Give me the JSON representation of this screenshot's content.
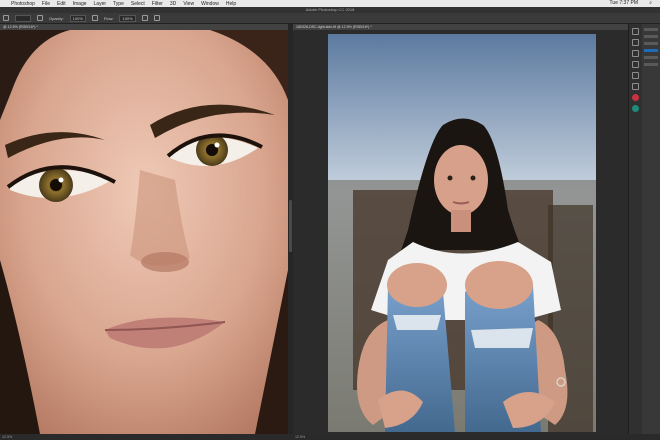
{
  "menubar": {
    "items": [
      "Photoshop",
      "File",
      "Edit",
      "Image",
      "Layer",
      "Type",
      "Select",
      "Filter",
      "3D",
      "View",
      "Window",
      "Help"
    ],
    "clock": "Tue 7:37 PM"
  },
  "window": {
    "title": "Adobe Photoshop CC 2018"
  },
  "options_bar": {
    "opacity_label": "Opacity:",
    "opacity_value": "100%",
    "flow_label": "Flow:",
    "flow_value": "100%"
  },
  "documents": {
    "left_tab": "@ 12.5% (RGB/16*) *",
    "right_tab": "180326-DSC-light-skin.tif @ 12.5% (RGB/16*) *"
  },
  "status_bar": {
    "left_zoom": "12.5%",
    "right_zoom": "12.5%"
  },
  "colors": {
    "accent_red": "#c8333f",
    "accent_teal": "#1f8c7b",
    "selection_blue": "#1e6bb8"
  }
}
